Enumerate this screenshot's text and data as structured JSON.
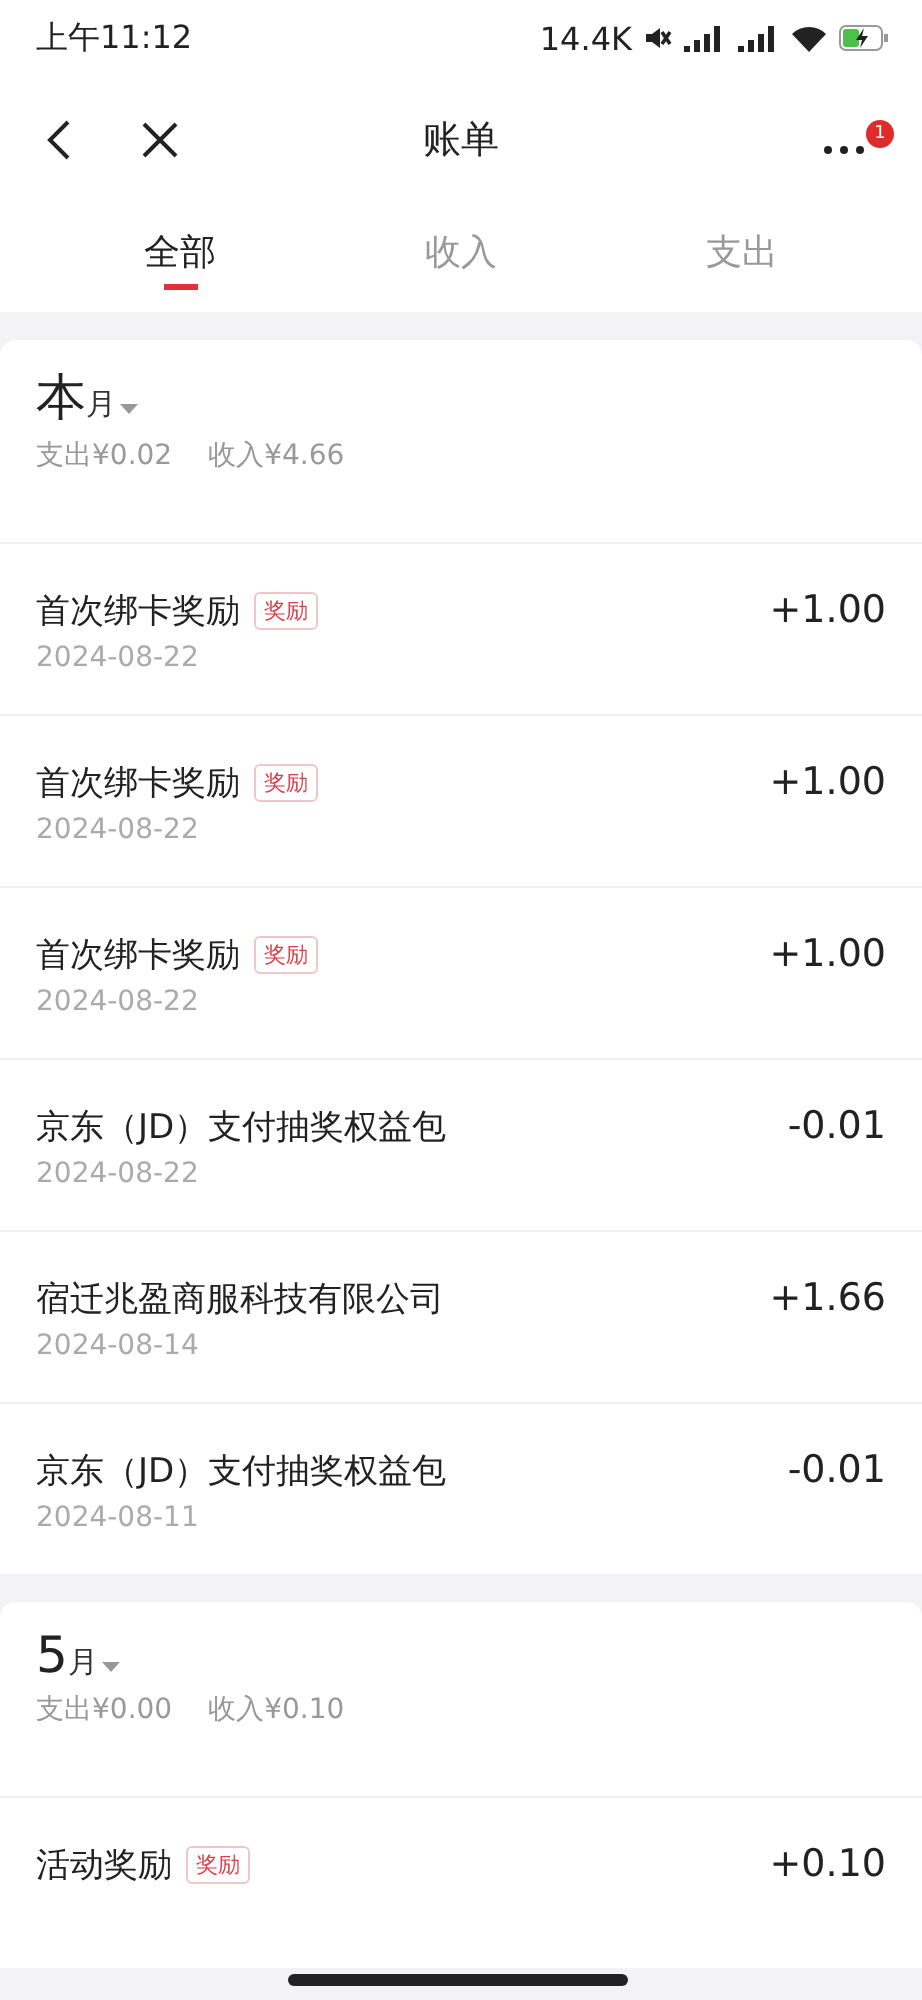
{
  "status_bar": {
    "time": "上午11:12",
    "speed": "14.4K"
  },
  "nav": {
    "title": "账单",
    "badge": "1"
  },
  "tabs": [
    {
      "label": "全部",
      "selected": true
    },
    {
      "label": "收入",
      "selected": false
    },
    {
      "label": "支出",
      "selected": false
    }
  ],
  "months": [
    {
      "big": "本",
      "small": "月",
      "summary": [
        "支出¥0.02",
        "收入¥4.66"
      ],
      "rows": [
        {
          "title": "首次绑卡奖励",
          "tag": "奖励",
          "date": "2024-08-22",
          "amount": "+1.00"
        },
        {
          "title": "首次绑卡奖励",
          "tag": "奖励",
          "date": "2024-08-22",
          "amount": "+1.00"
        },
        {
          "title": "首次绑卡奖励",
          "tag": "奖励",
          "date": "2024-08-22",
          "amount": "+1.00"
        },
        {
          "title": "京东（JD）支付抽奖权益包",
          "date": "2024-08-22",
          "amount": "-0.01"
        },
        {
          "title": "宿迁兆盈商服科技有限公司",
          "date": "2024-08-14",
          "amount": "+1.66"
        },
        {
          "title": "京东（JD）支付抽奖权益包",
          "date": "2024-08-11",
          "amount": "-0.01"
        }
      ]
    },
    {
      "big": "5",
      "small": "月",
      "summary": [
        "支出¥0.00",
        "收入¥0.10"
      ],
      "rows": [
        {
          "title": "活动奖励",
          "tag": "奖励",
          "amount": "+0.10"
        }
      ]
    }
  ]
}
